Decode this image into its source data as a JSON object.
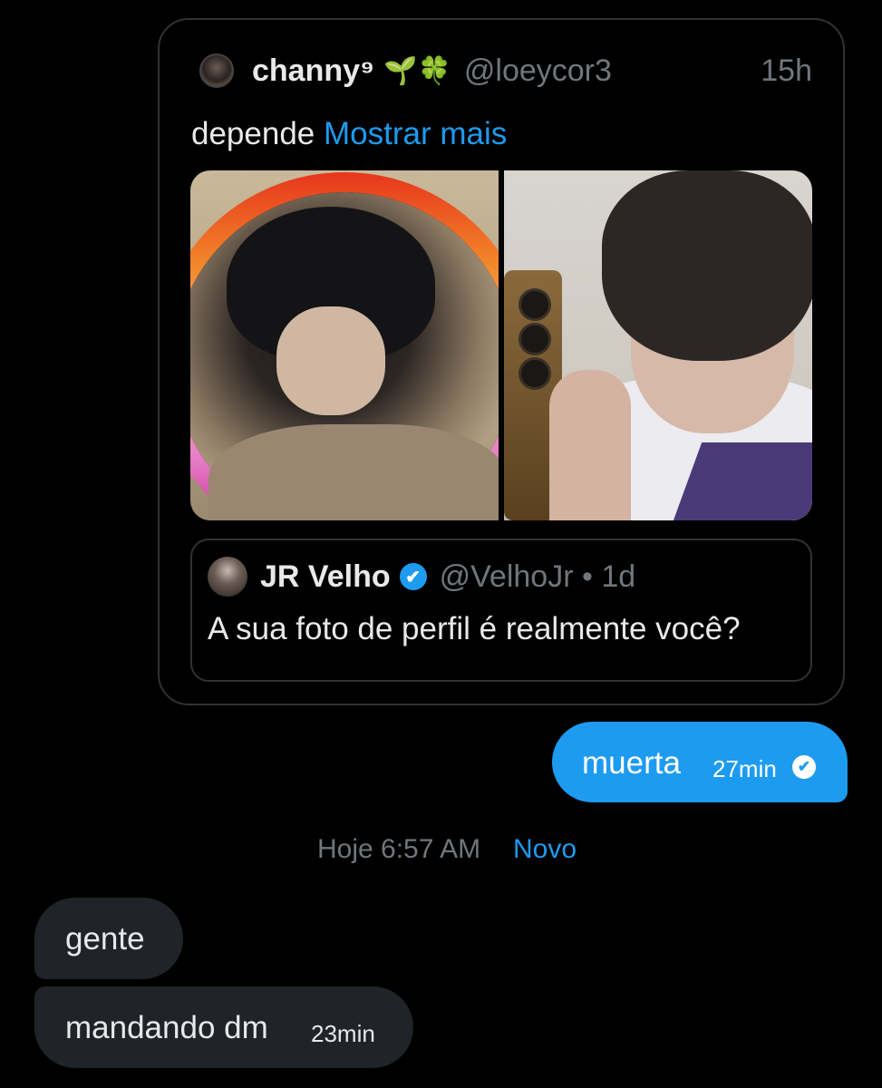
{
  "shared_tweet": {
    "display_name": "channy⁹",
    "emojis": "🌱🍀",
    "handle": "@loeycor3",
    "time": "15h",
    "text": "depende",
    "show_more": "Mostrar mais"
  },
  "quoted_tweet": {
    "display_name": "JR Velho",
    "verified_icon": "✔",
    "handle": "@VelhoJr",
    "separator": "•",
    "time": "1d",
    "text": "A sua foto de perfil é realmente você?"
  },
  "sent_message": {
    "text": "muerta",
    "time": "27min",
    "status_icon": "✔"
  },
  "divider": {
    "label": "Hoje 6:57 AM",
    "new_label": "Novo"
  },
  "received_messages": [
    {
      "text": "gente"
    },
    {
      "text": "mandando dm",
      "time": "23min"
    }
  ],
  "colors": {
    "accent": "#1d9bf0",
    "background": "#000000",
    "bubble_received": "#202327",
    "muted": "#71767b"
  }
}
